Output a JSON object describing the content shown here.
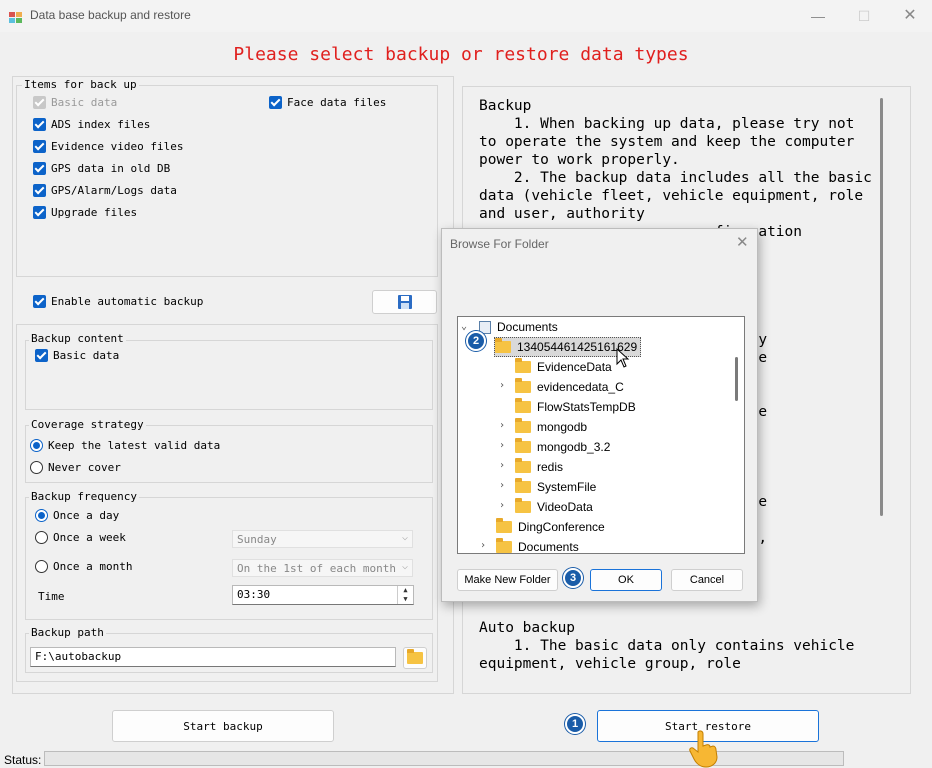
{
  "window": {
    "title": "Data base backup and restore",
    "heading": "Please select backup or restore data types"
  },
  "items_group": {
    "label": "Items for back up",
    "items": [
      {
        "label": "Basic data",
        "checked": true,
        "disabled": true
      },
      {
        "label": "ADS index files",
        "checked": true
      },
      {
        "label": "Evidence video files",
        "checked": true
      },
      {
        "label": "GPS data in old DB",
        "checked": true
      },
      {
        "label": "GPS/Alarm/Logs data",
        "checked": true
      },
      {
        "label": "Upgrade files",
        "checked": true
      }
    ],
    "face_data": {
      "label": "Face data files",
      "checked": true
    }
  },
  "auto_backup": {
    "label": "Enable automatic backup",
    "checked": true,
    "save_icon": "floppy-disk-icon"
  },
  "backup_content": {
    "label": "Backup content",
    "item": {
      "label": "Basic data",
      "checked": true
    }
  },
  "coverage": {
    "label": "Coverage strategy",
    "options": [
      {
        "label": "Keep the latest valid data",
        "selected": true
      },
      {
        "label": "Never cover",
        "selected": false
      }
    ]
  },
  "frequency": {
    "label": "Backup frequency",
    "options": [
      {
        "label": "Once a day",
        "selected": true
      },
      {
        "label": "Once a week",
        "selected": false
      },
      {
        "label": "Once a month",
        "selected": false
      }
    ],
    "week_value": "Sunday",
    "month_value": "On the 1st of each month",
    "time_label": "Time",
    "time_value": "03:30"
  },
  "backup_path": {
    "label": "Backup path",
    "value": "F:\\autobackup",
    "folder_icon": "folder-icon"
  },
  "buttons": {
    "start_backup": "Start backup",
    "start_restore": "Start restore"
  },
  "status": {
    "label": "Status:"
  },
  "info_text": "Backup\n    1. When backing up data, please try not to operate the system and keep the computer power to work properly.\n    2. The backup data includes all the basic data (vehicle fleet, vehicle equipment, role and user, authority\n                           figuration\n\n                      acked up\n\n\n\n                       please try\n                       d keep the\n                       rly.\n                       rom 3.0,\n                       e into the\n                        restore\n                        up the\n                        correct\n                       ile name\n                        file name\n                        the old\n                       sion.sql),\n                        or\n                       .sql'.\n\n\nAuto backup\n    1. The basic data only contains vehicle equipment, vehicle group, role",
  "dialog": {
    "title": "Browse For Folder",
    "tree": [
      {
        "label": "Documents",
        "level": 0,
        "expanded": true,
        "type": "docs"
      },
      {
        "label": "1340544614251616​29",
        "level": 1,
        "selected": true
      },
      {
        "label": "EvidenceData",
        "level": 2
      },
      {
        "label": "evidencedata_C",
        "level": 2,
        "has_children": true
      },
      {
        "label": "FlowStatsTempDB",
        "level": 2
      },
      {
        "label": "mongodb",
        "level": 2,
        "has_children": true
      },
      {
        "label": "mongodb_3.2",
        "level": 2,
        "has_children": true
      },
      {
        "label": "redis",
        "level": 2,
        "has_children": true
      },
      {
        "label": "SystemFile",
        "level": 2,
        "has_children": true
      },
      {
        "label": "VideoData",
        "level": 2,
        "has_children": true
      },
      {
        "label": "DingConference",
        "level": 1
      },
      {
        "label": "Documents",
        "level": 1,
        "has_children": true
      }
    ],
    "buttons": {
      "new_folder": "Make New Folder",
      "ok": "OK",
      "cancel": "Cancel"
    }
  },
  "annotations": {
    "step1": "1",
    "step2": "2",
    "step3": "3"
  }
}
